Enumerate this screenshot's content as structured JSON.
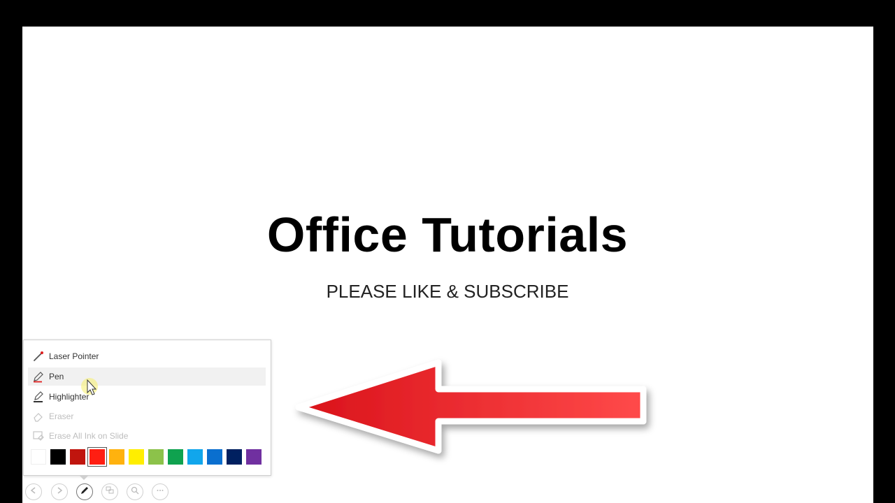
{
  "slide": {
    "title": "Office Tutorials",
    "subtitle": "PLEASE LIKE & SUBSCRIBE"
  },
  "pen_menu": {
    "items": [
      {
        "label": "Laser Pointer",
        "icon": "laser-pointer-icon",
        "enabled": true
      },
      {
        "label": "Pen",
        "icon": "pen-icon",
        "enabled": true,
        "highlighted": true
      },
      {
        "label": "Highlighter",
        "icon": "highlighter-icon",
        "enabled": true
      },
      {
        "label": "Eraser",
        "icon": "eraser-icon",
        "enabled": false
      },
      {
        "label": "Erase All Ink on Slide",
        "icon": "erase-all-icon",
        "enabled": false
      }
    ],
    "colors": [
      "#ffffff",
      "#000000",
      "#c0150e",
      "#ff1e12",
      "#ffb20e",
      "#ffee00",
      "#8cc24a",
      "#0fa24f",
      "#11a6ec",
      "#0a6fcf",
      "#002060",
      "#7030a0"
    ],
    "selected_color": "#ff1e12"
  },
  "toolbar": {
    "buttons": [
      {
        "icon": "previous-icon"
      },
      {
        "icon": "next-icon"
      },
      {
        "icon": "pen-tool-icon",
        "active": true
      },
      {
        "icon": "all-slides-icon"
      },
      {
        "icon": "zoom-icon"
      },
      {
        "icon": "more-options-icon"
      }
    ]
  },
  "annotation": {
    "arrow_color": "#e8161c"
  }
}
